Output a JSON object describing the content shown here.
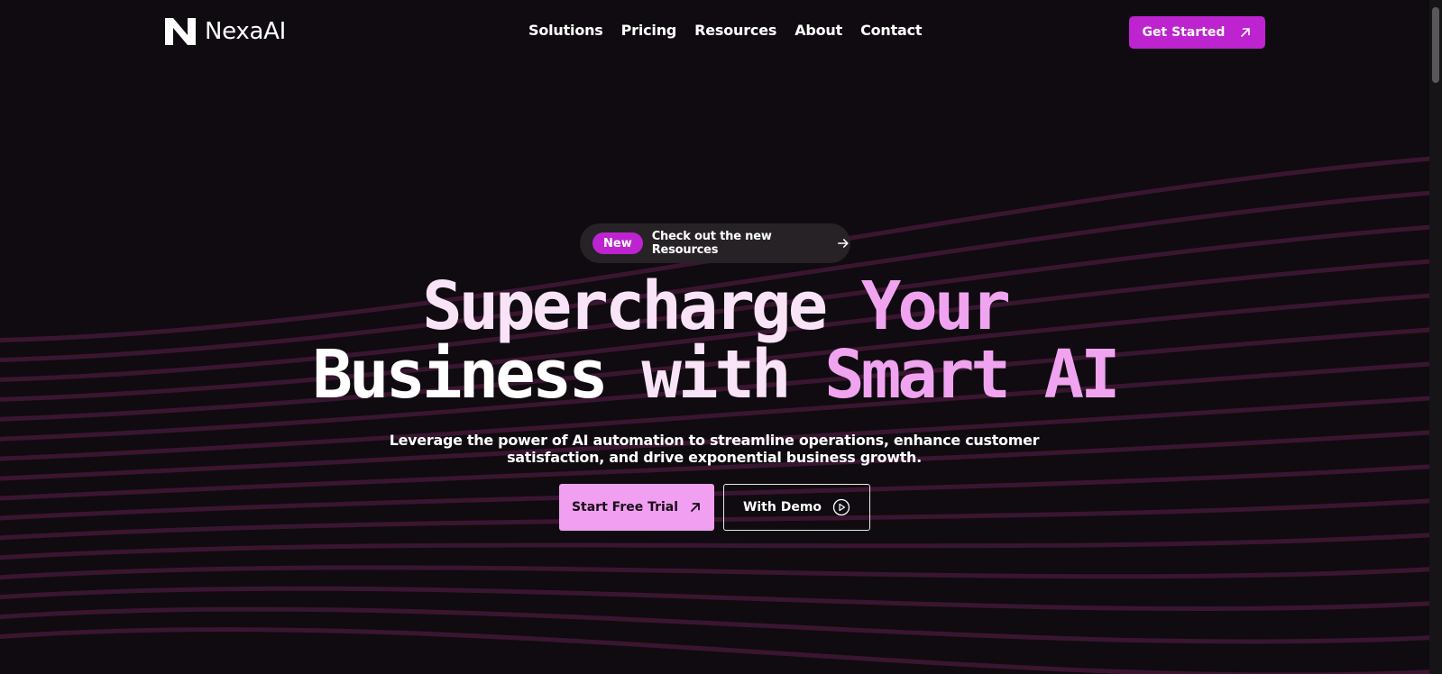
{
  "brand": {
    "name": "NexaAI",
    "logo_icon": "n-logo-mark"
  },
  "nav": {
    "items": [
      {
        "label": "Solutions"
      },
      {
        "label": "Pricing"
      },
      {
        "label": "Resources"
      },
      {
        "label": "About"
      },
      {
        "label": "Contact"
      }
    ],
    "cta_label": "Get Started",
    "cta_icon": "arrow-up-right-icon"
  },
  "announcement": {
    "badge": "New",
    "text": "Check out the new Resources",
    "icon": "arrow-right-icon"
  },
  "hero": {
    "headline_line1": {
      "part1": "Supercharge",
      "part2": "Your"
    },
    "headline_line2": {
      "part1": "Business",
      "part2": "with",
      "part3": "Smart AI"
    },
    "subtitle": "Leverage the power of AI automation to streamline operations, enhance customer satisfaction, and drive exponential business growth.",
    "primary_cta": "Start Free Trial",
    "secondary_cta": "With Demo"
  },
  "colors": {
    "background": "#0f0b10",
    "accent": "#bd24cf",
    "accent_light": "#f19ff1",
    "headline_pink": "#f0a4f0",
    "headline_light": "#f9e3f7",
    "wave_lines": "#3a1530"
  }
}
